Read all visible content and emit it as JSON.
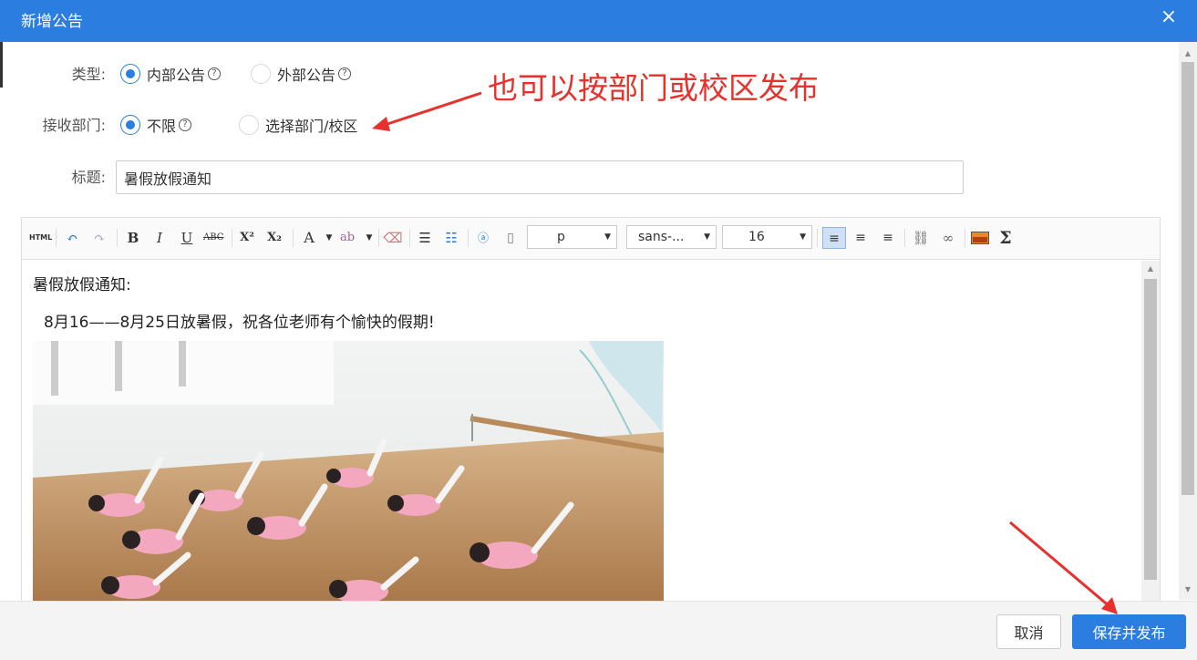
{
  "dialog": {
    "title": "新增公告",
    "close_icon": "×"
  },
  "form": {
    "type_label": "类型:",
    "type_options": [
      {
        "label": "内部公告",
        "selected": true
      },
      {
        "label": "外部公告",
        "selected": false
      }
    ],
    "dept_label": "接收部门:",
    "dept_options": [
      {
        "label": "不限",
        "selected": true
      },
      {
        "label": "选择部门/校区",
        "selected": false
      }
    ],
    "title_label": "标题:",
    "title_value": "暑假放假通知",
    "help_glyph": "?"
  },
  "annotation": {
    "text": "也可以按部门或校区发布",
    "color": "#e8302c"
  },
  "toolbar": {
    "html_label": "HTML",
    "bold": "B",
    "italic": "I",
    "underline": "U",
    "strike": "ABC",
    "superscript": "X²",
    "subscript": "X₂",
    "font_color": "A",
    "paragraph_value": "p",
    "font_value": "sans-...",
    "size_value": "16"
  },
  "content": {
    "line1": "暑假放假通知:",
    "line2": "8月16——8月25日放暑假，祝各位老师有个愉快的假期!"
  },
  "footer": {
    "cancel_label": "取消",
    "publish_label": "保存并发布"
  },
  "colors": {
    "primary": "#2b7de0",
    "annotation": "#e8302c"
  }
}
